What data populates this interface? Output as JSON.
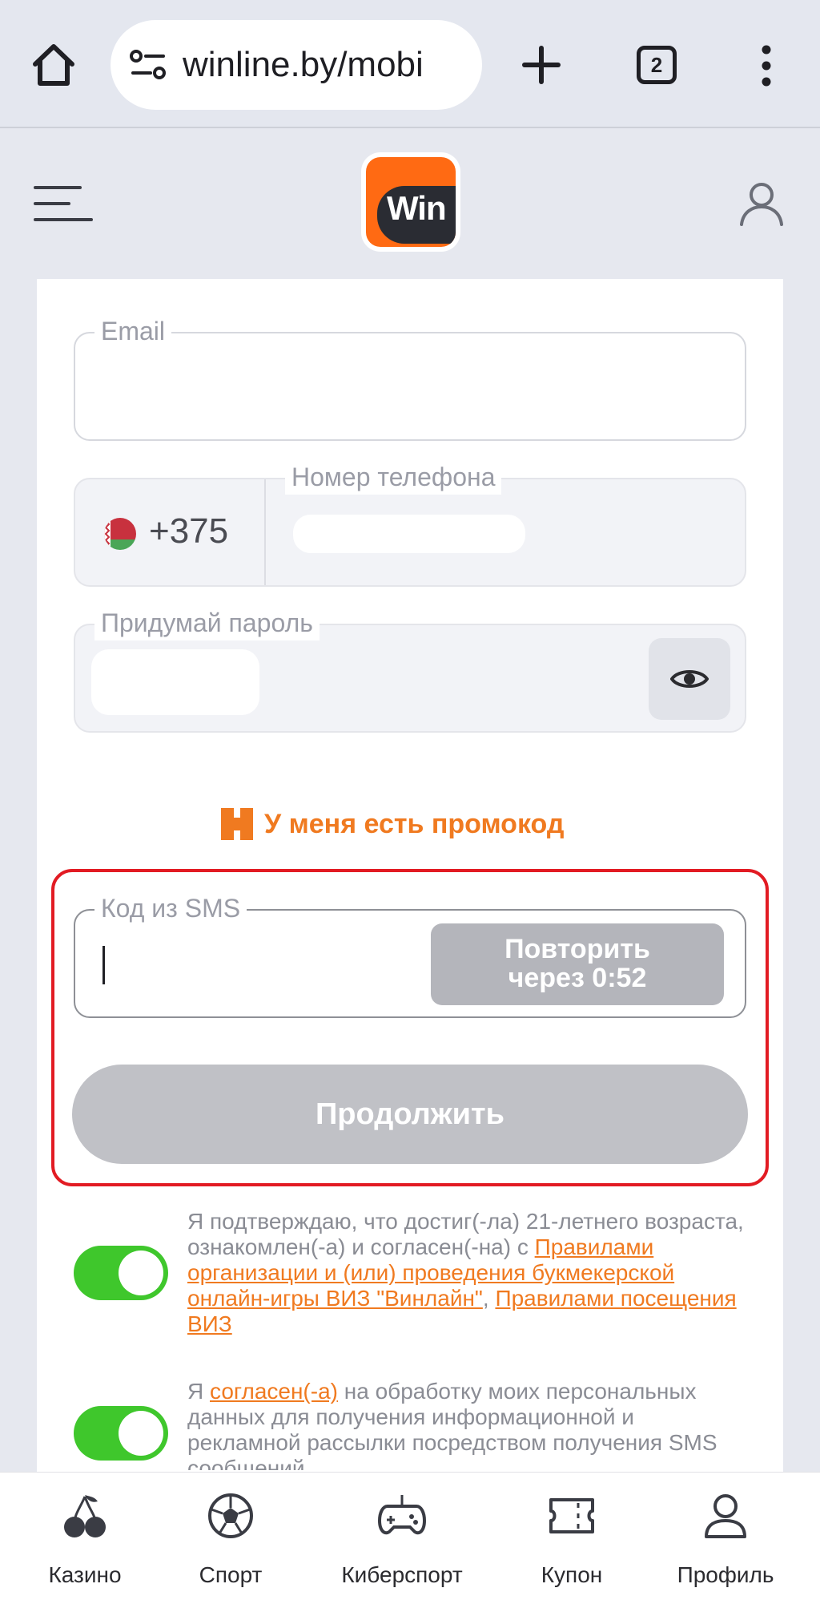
{
  "browser": {
    "url": "winline.by/mobi",
    "tab_count": "2"
  },
  "header": {
    "logo_text": "Win"
  },
  "form": {
    "email": {
      "label": "Email",
      "value": ""
    },
    "phone": {
      "label": "Номер телефона",
      "prefix": "+375",
      "value": ""
    },
    "password": {
      "label": "Придумай пароль",
      "value": ""
    },
    "promo_label": "У меня есть промокод",
    "sms": {
      "label": "Код из SMS",
      "value": "",
      "resend_line1": "Повторить",
      "resend_line2": "через 0:52"
    },
    "continue_label": "Продолжить"
  },
  "consents": [
    {
      "checked": true,
      "text_before": "Я подтверждаю, что достиг(-ла) 21-летнего возраста, ознакомлен(-а) и согласен(-на) с ",
      "link1": "Правилами организации и (или) проведения букмекерской онлайн-игры ВИЗ \"Винлайн\"",
      "sep": ", ",
      "link2": "Правилами посещения ВИЗ"
    },
    {
      "checked": true,
      "text_before": "Я ",
      "link1": "согласен(-а)",
      "text_after": " на обработку моих персональных данных для получения информационной и рекламной рассылки посредством получения SMS сообщений"
    }
  ],
  "bottom_nav": [
    {
      "label": "Казино",
      "icon": "cherries-icon"
    },
    {
      "label": "Спорт",
      "icon": "soccer-ball-icon"
    },
    {
      "label": "Киберспорт",
      "icon": "gamepad-icon"
    },
    {
      "label": "Купон",
      "icon": "ticket-icon"
    },
    {
      "label": "Профиль",
      "icon": "profile-icon"
    }
  ],
  "colors": {
    "accent": "#f07a20",
    "toggle_on": "#3fc72c",
    "highlight_border": "#e21b23",
    "disabled_button": "#c0c1c6"
  }
}
